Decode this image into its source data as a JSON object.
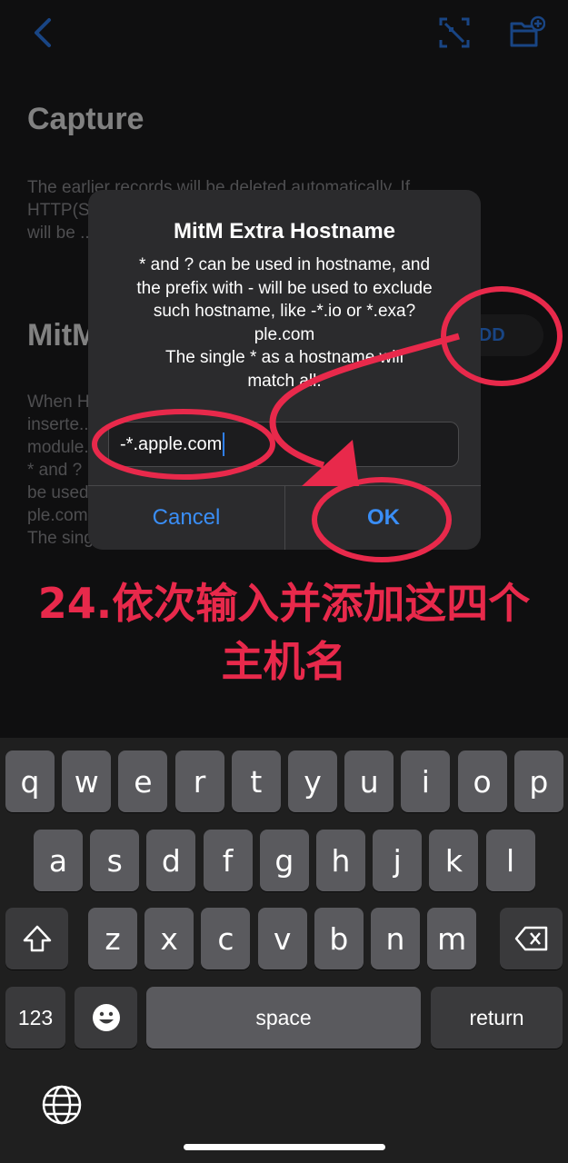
{
  "page": {
    "title": "Capture",
    "desc1_lines": [
      "The earlier records will be deleted automatically. If",
      "HTTP(S) ... results",
      "will be ..."
    ],
    "section_title": "MitM",
    "add_label": "ADD",
    "desc2_lines": [
      "When H... will be",
      "inserte...",
      "module...",
      "* and ? ... n - will",
      "be used ... n?",
      "ple.com",
      "The sing..."
    ]
  },
  "alert": {
    "title": "MitM Extra Hostname",
    "message_lines": [
      "* and ? can be used in hostname, and",
      "the prefix with - will be used to exclude",
      "such hostname, like -*.io or *.exa?",
      "ple.com",
      "The single * as a hostname will",
      "match all."
    ],
    "input_value": "-*.apple.com",
    "cancel_label": "Cancel",
    "ok_label": "OK"
  },
  "annotation": {
    "line1": "24.依次输入并添加这四个",
    "line2": "主机名",
    "color": "#e8294b"
  },
  "keyboard": {
    "row1": [
      "q",
      "w",
      "e",
      "r",
      "t",
      "y",
      "u",
      "i",
      "o",
      "p"
    ],
    "row2": [
      "a",
      "s",
      "d",
      "f",
      "g",
      "h",
      "j",
      "k",
      "l"
    ],
    "row3": [
      "z",
      "x",
      "c",
      "v",
      "b",
      "n",
      "m"
    ],
    "numbers_label": "123",
    "space_label": "space",
    "return_label": "return"
  },
  "colors": {
    "accent": "#3a8ef6",
    "annotation": "#e8294b"
  }
}
